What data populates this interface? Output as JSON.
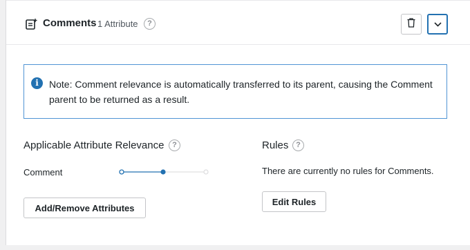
{
  "header": {
    "title": "Comments",
    "attribute_count": "1 Attribute",
    "help_glyph": "?",
    "icons": {
      "type": "comment-post-icon",
      "delete": "trash-icon",
      "toggle": "chevron-down-icon"
    }
  },
  "notice": {
    "icon_glyph": "i",
    "text": "Note: Comment relevance is automatically transferred to its parent, causing the Comment parent to be returned as a result."
  },
  "attributes": {
    "title": "Applicable Attribute Relevance",
    "items": [
      {
        "label": "Comment",
        "relevance": 2,
        "relevance_max": 3
      }
    ],
    "button_label": "Add/Remove Attributes"
  },
  "rules": {
    "title": "Rules",
    "empty_text": "There are currently no rules for Comments.",
    "button_label": "Edit Rules"
  },
  "colors": {
    "accent": "#2271b1",
    "notice_border": "#4f94d4",
    "border": "#c3c4c7",
    "text": "#1d2327",
    "muted": "#8c8f94"
  }
}
